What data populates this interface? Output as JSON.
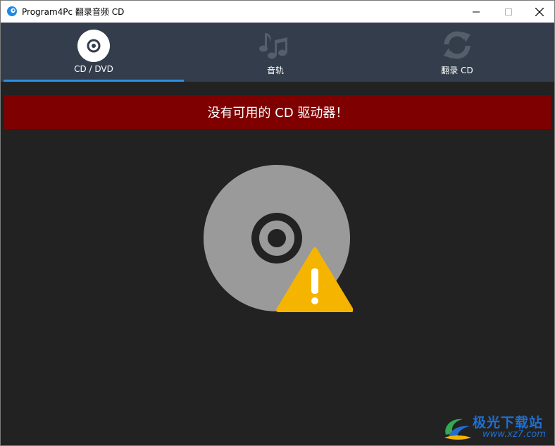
{
  "window": {
    "title": "Program4Pc 翻录音频 CD",
    "app_icon": "program4pc-logo-icon",
    "controls": {
      "minimize": "minimize-icon",
      "maximize": "maximize-icon",
      "close": "close-icon"
    }
  },
  "tabs": [
    {
      "label": "CD / DVD",
      "icon": "disc-icon",
      "active": true
    },
    {
      "label": "音轨",
      "icon": "music-notes-icon",
      "active": false
    },
    {
      "label": "翻录 CD",
      "icon": "refresh-icon",
      "active": false
    }
  ],
  "banner": {
    "message": "没有可用的 CD 驱动器！",
    "color": "#7e0000"
  },
  "illustration": {
    "icon": "disc-warning-icon"
  },
  "colors": {
    "background": "#222222",
    "tabbar": "#343d4b",
    "accent": "#2b8fe6",
    "warning": "#f4b400",
    "disc": "#9a9a9a"
  },
  "watermark": {
    "title": "极光下载站",
    "url": "www.xz7.com",
    "icon": "aurora-logo-icon"
  }
}
